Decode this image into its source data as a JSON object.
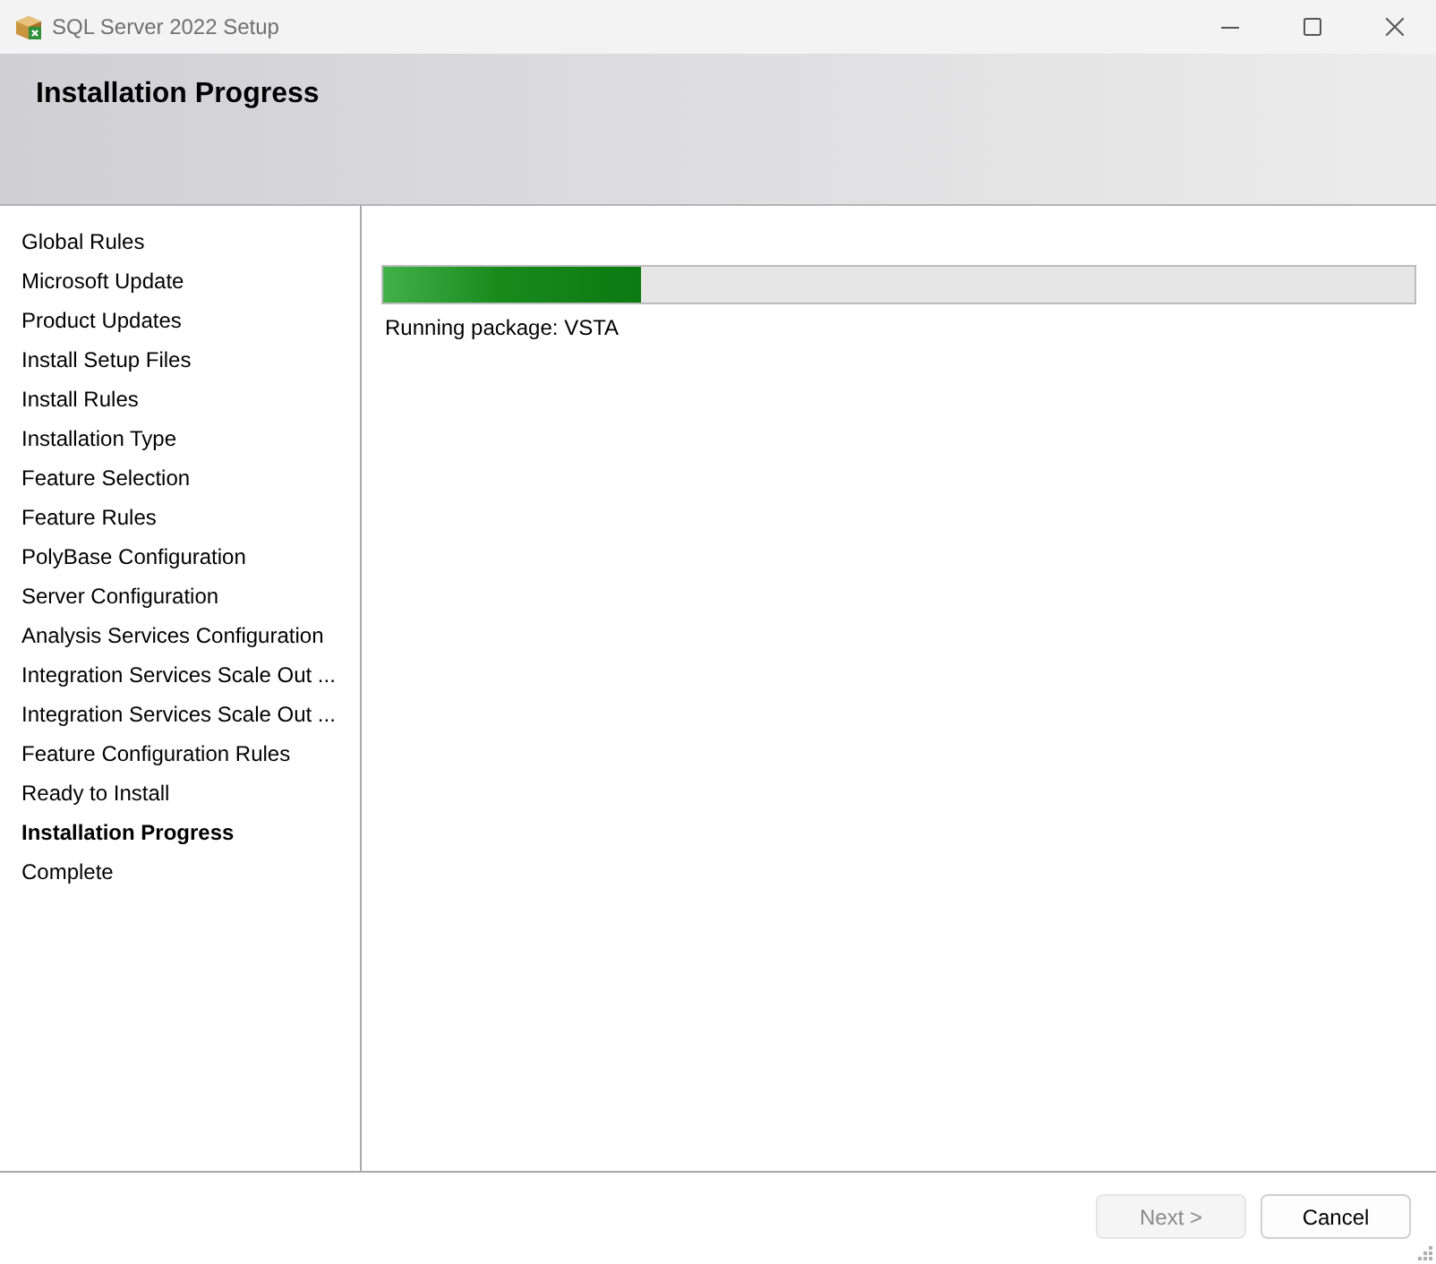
{
  "window": {
    "title": "SQL Server 2022 Setup"
  },
  "header": {
    "title": "Installation Progress"
  },
  "steps": [
    {
      "label": "Global Rules",
      "selected": false
    },
    {
      "label": "Microsoft Update",
      "selected": false
    },
    {
      "label": "Product Updates",
      "selected": false
    },
    {
      "label": "Install Setup Files",
      "selected": false
    },
    {
      "label": "Install Rules",
      "selected": false
    },
    {
      "label": "Installation Type",
      "selected": false
    },
    {
      "label": "Feature Selection",
      "selected": false
    },
    {
      "label": "Feature Rules",
      "selected": false
    },
    {
      "label": "PolyBase Configuration",
      "selected": false
    },
    {
      "label": "Server Configuration",
      "selected": false
    },
    {
      "label": "Analysis Services Configuration",
      "selected": false
    },
    {
      "label": "Integration Services Scale Out ...",
      "selected": false
    },
    {
      "label": "Integration Services Scale Out ...",
      "selected": false
    },
    {
      "label": "Feature Configuration Rules",
      "selected": false
    },
    {
      "label": "Ready to Install",
      "selected": false
    },
    {
      "label": "Installation Progress",
      "selected": true
    },
    {
      "label": "Complete",
      "selected": false
    }
  ],
  "progress": {
    "level": 0.25,
    "status": "Running package: VSTA"
  },
  "buttons": [
    {
      "label": "Next >",
      "disabled": true
    },
    {
      "label": "Cancel",
      "disabled": false
    }
  ]
}
